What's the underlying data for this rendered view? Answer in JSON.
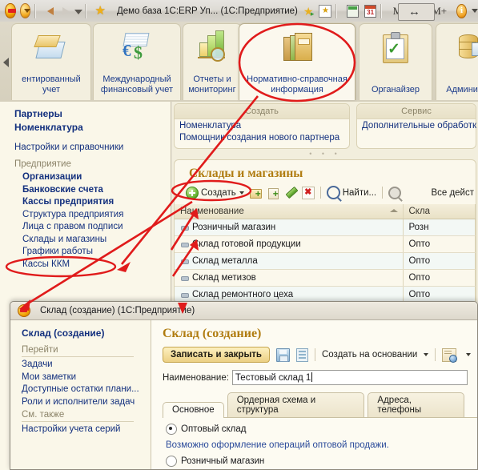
{
  "titlebar": {
    "title": "Демо база 1С:ERP Уп...  (1С:Предприятие)",
    "m_label": "M",
    "mplus_label": "M+",
    "mplus2_label": "M+",
    "info_label": "i"
  },
  "sections": [
    {
      "label": "ентированный учет",
      "icon": "documents-icon",
      "active": false
    },
    {
      "label": "Международный финансовый учет",
      "icon": "currency-icon",
      "active": false
    },
    {
      "label": "Отчеты и мониторинг",
      "icon": "chart-icon",
      "active": false
    },
    {
      "label": "Нормативно-справочная информация",
      "icon": "books-icon",
      "active": true
    },
    {
      "label": "Органайзер",
      "icon": "clipboard-icon",
      "active": false
    },
    {
      "label": "Администр...",
      "icon": "database-icon",
      "active": false
    }
  ],
  "sidebar": {
    "important": [
      "Партнеры",
      "Номенклатура"
    ],
    "link": "Настройки и справочники",
    "group": "Предприятие",
    "bold_items": [
      "Организации",
      "Банковские счета",
      "Кассы предприятия"
    ],
    "items": [
      "Структура предприятия",
      "Лица с правом подписи",
      "Склады и магазины",
      "Графики работы",
      "Кассы ККМ"
    ]
  },
  "panels": [
    {
      "title": "Создать",
      "links": [
        "Номенклатура",
        "Помощник создания нового партнера"
      ]
    },
    {
      "title": "Сервис",
      "links": [
        "Дополнительные обработк"
      ]
    }
  ],
  "list": {
    "title": "Склады и магазины",
    "toolbar": {
      "create": "Создать",
      "find": "Найти...",
      "all_actions": "Все дейст"
    },
    "columns": [
      "Наименование",
      "Скла"
    ],
    "rows": [
      {
        "name": "Розничный магазин",
        "type": "Розн"
      },
      {
        "name": "Склад готовой продукции",
        "type": "Опто"
      },
      {
        "name": "Склад металла",
        "type": "Опто"
      },
      {
        "name": "Склад метизов",
        "type": "Опто"
      },
      {
        "name": "Склад ремонтного цеха",
        "type": "Опто"
      }
    ]
  },
  "modal": {
    "titlebar": "Склад (создание)  (1С:Предприятие)",
    "nav": {
      "heading": "Склад (создание)",
      "group1": "Перейти",
      "group1_links": [
        "Задачи",
        "Мои заметки",
        "Доступные остатки плани...",
        "Роли и исполнители задач"
      ],
      "group2": "См. также",
      "group2_links": [
        "Настройки учета серий"
      ]
    },
    "heading": "Склад (создание)",
    "toolbar": {
      "save_close": "Записать и закрыть",
      "create_based_on": "Создать на основании"
    },
    "field": {
      "label": "Наименование:",
      "value": "Тестовый склад 1"
    },
    "tabs": [
      {
        "label": "Основное",
        "active": true
      },
      {
        "label": "Ордерная схема и структура",
        "active": false
      },
      {
        "label": "Адреса, телефоны",
        "active": false
      }
    ],
    "options": [
      {
        "label": "Оптовый склад",
        "selected": true
      },
      {
        "label": "Розничный магазин",
        "selected": false
      }
    ],
    "hint": "Возможно оформление операций оптовой продажи."
  },
  "annotation": {
    "color": "#e01b1b"
  }
}
